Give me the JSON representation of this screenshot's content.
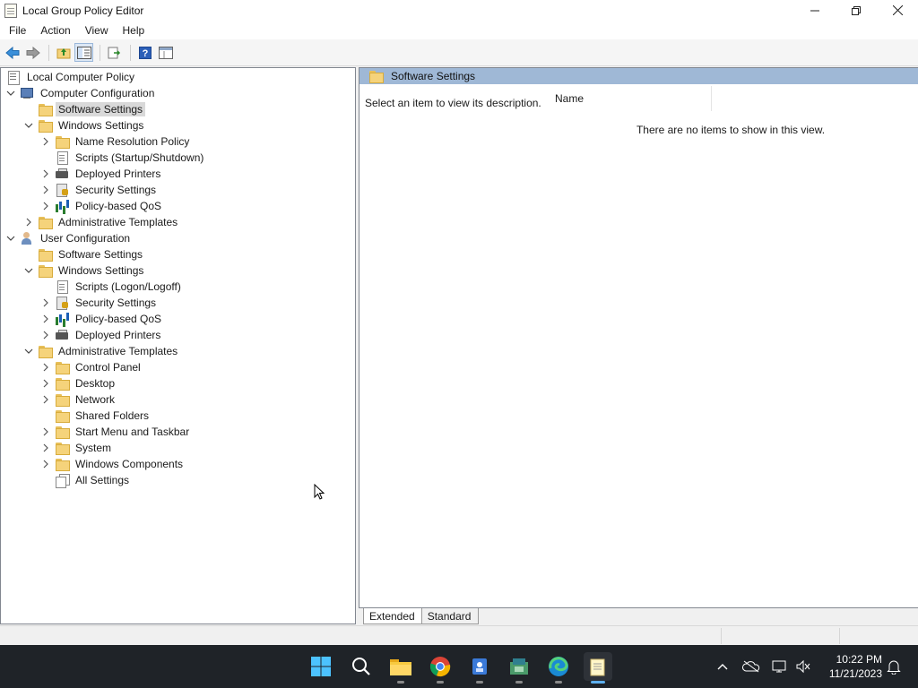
{
  "window": {
    "title": "Local Group Policy Editor",
    "controls": [
      "minimize-icon",
      "restore-icon",
      "close-icon"
    ]
  },
  "menu": [
    "File",
    "Action",
    "View",
    "Help"
  ],
  "toolbar": [
    "back-arrow-icon",
    "forward-arrow-icon",
    "up-folder-icon",
    "show-hide-tree-icon",
    "export-list-icon",
    "help-icon",
    "properties-icon"
  ],
  "tree": [
    {
      "label": "Local Computer Policy",
      "level": 0,
      "expander": "none",
      "icon": "policy-icon"
    },
    {
      "label": "Computer Configuration",
      "level": 0,
      "expander": "open",
      "icon": "computer-icon"
    },
    {
      "label": "Software Settings",
      "level": 1,
      "expander": "none",
      "icon": "folder-icon",
      "selected": true
    },
    {
      "label": "Windows Settings",
      "level": 1,
      "expander": "open",
      "icon": "folder-icon"
    },
    {
      "label": "Name Resolution Policy",
      "level": 2,
      "expander": "closed",
      "icon": "folder-icon"
    },
    {
      "label": "Scripts (Startup/Shutdown)",
      "level": 2,
      "expander": "none",
      "icon": "script-icon"
    },
    {
      "label": "Deployed Printers",
      "level": 2,
      "expander": "closed",
      "icon": "printer-icon"
    },
    {
      "label": "Security Settings",
      "level": 2,
      "expander": "closed",
      "icon": "security-icon"
    },
    {
      "label": "Policy-based QoS",
      "level": 2,
      "expander": "closed",
      "icon": "chart-icon"
    },
    {
      "label": "Administrative Templates",
      "level": 1,
      "expander": "closed",
      "icon": "folder-icon"
    },
    {
      "label": "User Configuration",
      "level": 0,
      "expander": "open",
      "icon": "user-icon"
    },
    {
      "label": "Software Settings",
      "level": 1,
      "expander": "none",
      "icon": "folder-icon"
    },
    {
      "label": "Windows Settings",
      "level": 1,
      "expander": "open",
      "icon": "folder-icon"
    },
    {
      "label": "Scripts (Logon/Logoff)",
      "level": 2,
      "expander": "none",
      "icon": "script-icon"
    },
    {
      "label": "Security Settings",
      "level": 2,
      "expander": "closed",
      "icon": "security-icon"
    },
    {
      "label": "Policy-based QoS",
      "level": 2,
      "expander": "closed",
      "icon": "chart-icon"
    },
    {
      "label": "Deployed Printers",
      "level": 2,
      "expander": "closed",
      "icon": "printer-icon"
    },
    {
      "label": "Administrative Templates",
      "level": 1,
      "expander": "open",
      "icon": "folder-icon"
    },
    {
      "label": "Control Panel",
      "level": 2,
      "expander": "closed",
      "icon": "folder-icon"
    },
    {
      "label": "Desktop",
      "level": 2,
      "expander": "closed",
      "icon": "folder-icon"
    },
    {
      "label": "Network",
      "level": 2,
      "expander": "closed",
      "icon": "folder-icon"
    },
    {
      "label": "Shared Folders",
      "level": 2,
      "expander": "none",
      "icon": "folder-icon"
    },
    {
      "label": "Start Menu and Taskbar",
      "level": 2,
      "expander": "closed",
      "icon": "folder-icon"
    },
    {
      "label": "System",
      "level": 2,
      "expander": "closed",
      "icon": "folder-icon"
    },
    {
      "label": "Windows Components",
      "level": 2,
      "expander": "closed",
      "icon": "folder-icon"
    },
    {
      "label": "All Settings",
      "level": 2,
      "expander": "none",
      "icon": "all-settings-icon"
    }
  ],
  "details": {
    "header_title": "Software Settings",
    "description": "Select an item to view its description.",
    "column_name": "Name",
    "empty_message": "There are no items to show in this view."
  },
  "tabs": [
    "Extended",
    "Standard"
  ],
  "taskbar": {
    "apps": [
      "start-icon",
      "search-icon",
      "file-explorer-icon",
      "chrome-icon",
      "app-icon",
      "app-icon-2",
      "edge-icon",
      "notepad-icon"
    ],
    "time": "10:22 PM",
    "date": "11/21/2023"
  },
  "colors": {
    "header_bg": "#9fb8d6",
    "selection_bg": "#d9d9d9",
    "taskbar_bg": "#1f2328"
  }
}
